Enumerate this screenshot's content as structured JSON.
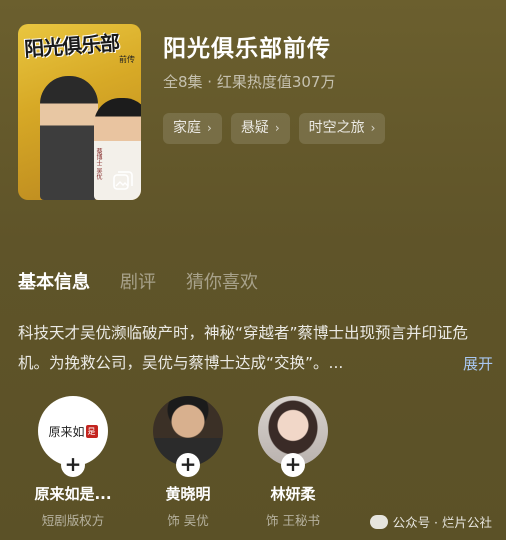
{
  "show": {
    "title": "阳光俱乐部前传",
    "meta": "全8集 · 红果热度值307万",
    "poster": {
      "title_art": "阳光俱乐部",
      "subtitle_art": "前传",
      "side_text": "蔡博士 吴优",
      "icon": "gallery-icon"
    },
    "tags": [
      {
        "label": "家庭"
      },
      {
        "label": "悬疑"
      },
      {
        "label": "时空之旅"
      }
    ]
  },
  "tabs": [
    {
      "label": "基本信息",
      "active": true
    },
    {
      "label": "剧评",
      "active": false
    },
    {
      "label": "猜你喜欢",
      "active": false
    }
  ],
  "description": {
    "text": "科技天才吴优濒临破产时，神秘“穿越者”蔡博士出现预言并印证危机。为挽救公司，吴优与蔡博士达成“交换”。...",
    "expand_label": "展开"
  },
  "cast": [
    {
      "name": "原来如是...",
      "role": "短剧版权方",
      "avatar_text": "原来如",
      "avatar_seal": "是"
    },
    {
      "name": "黄晓明",
      "role": "饰 吴优"
    },
    {
      "name": "林妍柔",
      "role": "饰 王秘书"
    }
  ],
  "watermark": "公众号 · 烂片公社",
  "icons": {
    "chevron": "chevron-right-icon",
    "plus": "plus-icon",
    "watermark": "wechat-icon"
  }
}
